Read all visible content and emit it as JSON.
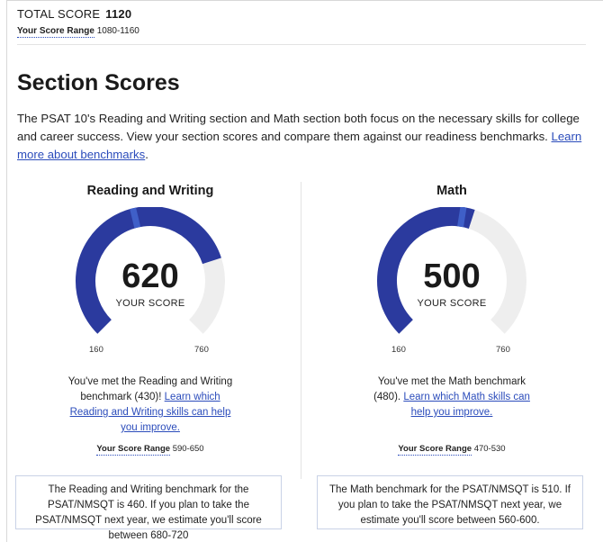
{
  "total": {
    "label": "TOTAL SCORE",
    "score": "1120",
    "range_label": "Your Score Range",
    "range": "1080-1160"
  },
  "section": {
    "title": "Section Scores",
    "intro_text": "The PSAT 10's Reading and Writing section and Math section both focus on the necessary skills for college and career success. View your section scores and compare them against our readiness benchmarks. ",
    "intro_link": "Learn more about benchmarks",
    "intro_end": "."
  },
  "gauges": {
    "min": 160,
    "max": 760,
    "track_color": "#eeeeee",
    "fill_color": "#2b3a9e",
    "marker_color": "#3f5fc8"
  },
  "reading_writing": {
    "title": "Reading and Writing",
    "score": 620,
    "benchmark": 430,
    "score_label": "YOUR SCORE",
    "tick_min": "160",
    "tick_max": "760",
    "message_text": "You've met the Reading and Writing benchmark (430)! ",
    "message_link": "Learn which Reading and Writing skills can help you improve.",
    "range_label": "Your Score Range",
    "range": "590-650",
    "benchmark_note": "The Reading and Writing benchmark for the PSAT/NMSQT is 460. If you plan to take the PSAT/NMSQT next year, we estimate you'll score between 680-720"
  },
  "math": {
    "title": "Math",
    "score": 500,
    "benchmark": 480,
    "score_label": "YOUR SCORE",
    "tick_min": "160",
    "tick_max": "760",
    "message_text": "You've met the Math benchmark (480). ",
    "message_link": "Learn which Math skills can help you improve.",
    "range_label": "Your Score Range",
    "range": "470-530",
    "benchmark_note": "The Math benchmark for the PSAT/NMSQT is 510. If you plan to take the PSAT/NMSQT next year, we estimate you'll score between 560-600."
  }
}
